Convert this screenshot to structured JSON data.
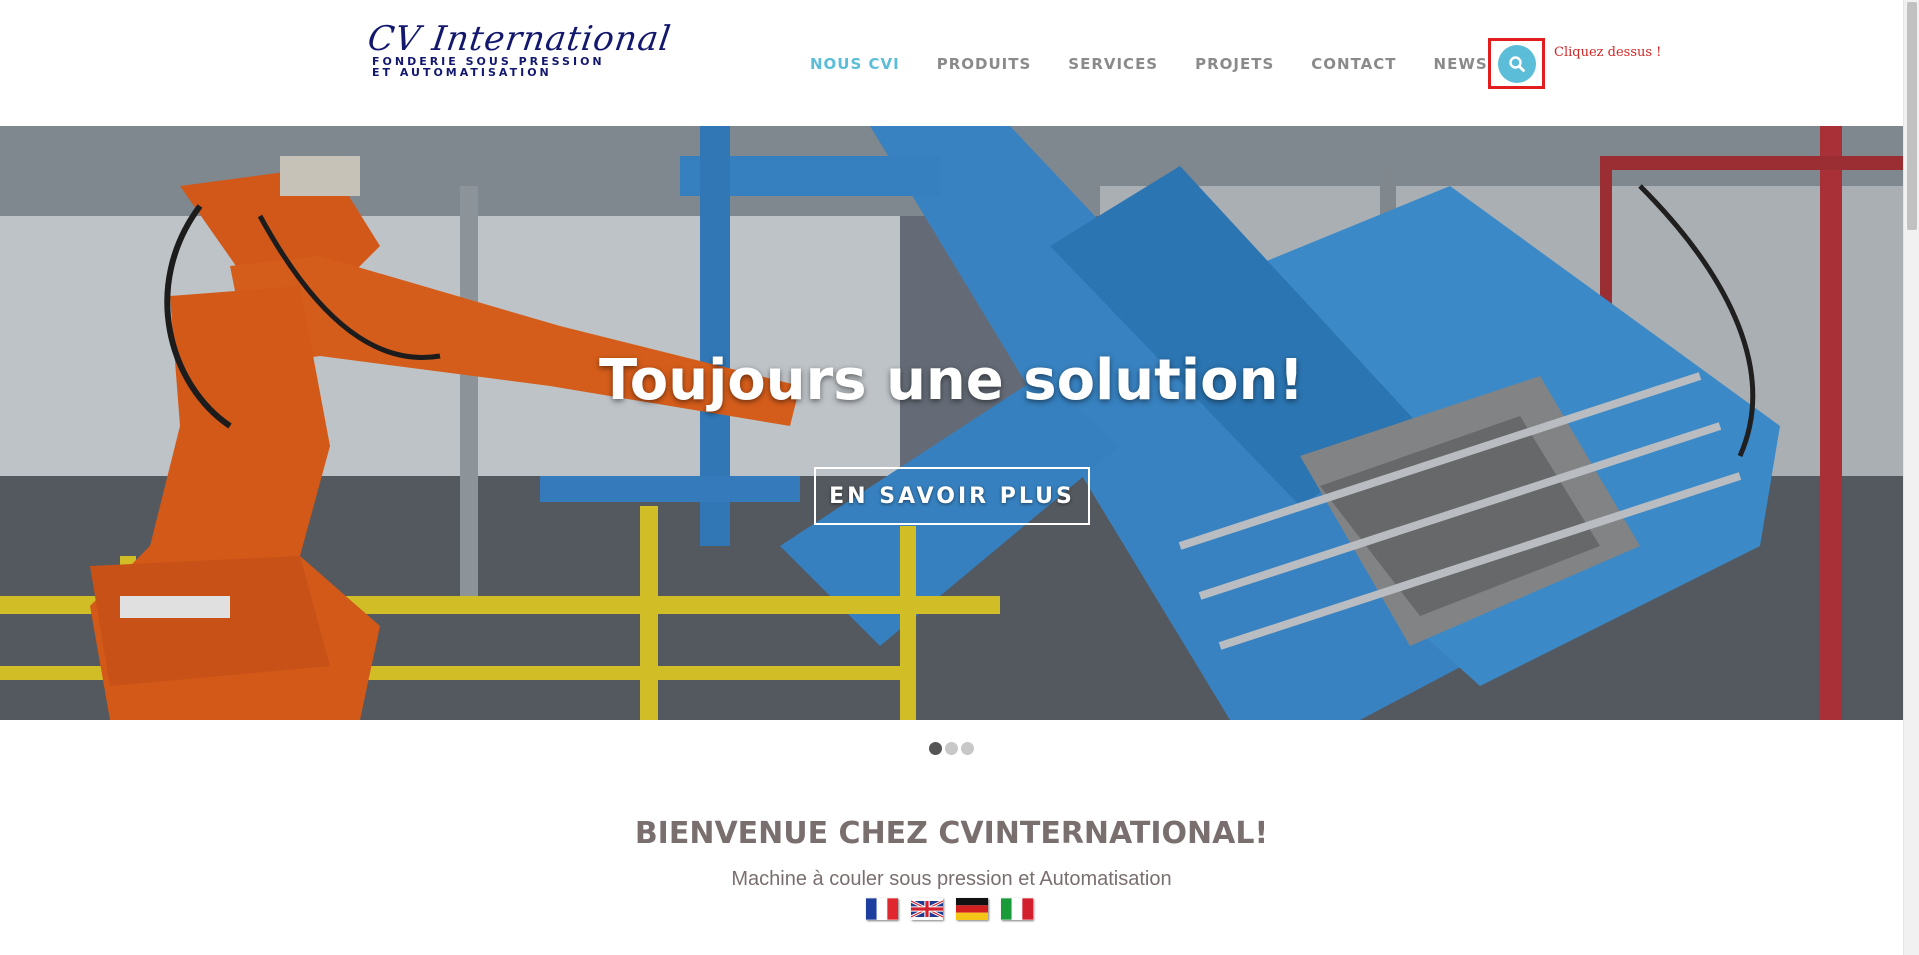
{
  "brand": {
    "logo_title": "CV International",
    "logo_subtitle_1": "FONDERIE SOUS PRESSION",
    "logo_subtitle_2": "ET AUTOMATISATION"
  },
  "nav": {
    "items": [
      {
        "label": "NOUS CVI",
        "active": true
      },
      {
        "label": "PRODUITS",
        "active": false
      },
      {
        "label": "SERVICES",
        "active": false
      },
      {
        "label": "PROJETS",
        "active": false
      },
      {
        "label": "CONTACT",
        "active": false
      },
      {
        "label": "NEWS",
        "active": false
      }
    ],
    "search_hint": "Cliquez dessus !"
  },
  "hero": {
    "title": "Toujours une solution!",
    "button_label": "EN SAVOIR PLUS",
    "slide_count": 3,
    "active_slide": 1
  },
  "welcome": {
    "heading": "BIENVENUE CHEZ CVINTERNATIONAL!",
    "subtitle": "Machine à couler sous pression et Automatisation"
  },
  "flags": [
    "flag-france-icon",
    "flag-uk-icon",
    "flag-germany-icon",
    "flag-italy-icon"
  ],
  "colors": {
    "accent": "#5bbdd7",
    "nav_text": "#8a8a8a",
    "heading": "#7a6f6f",
    "logo": "#13186e",
    "highlight_border": "#e11d1d"
  }
}
